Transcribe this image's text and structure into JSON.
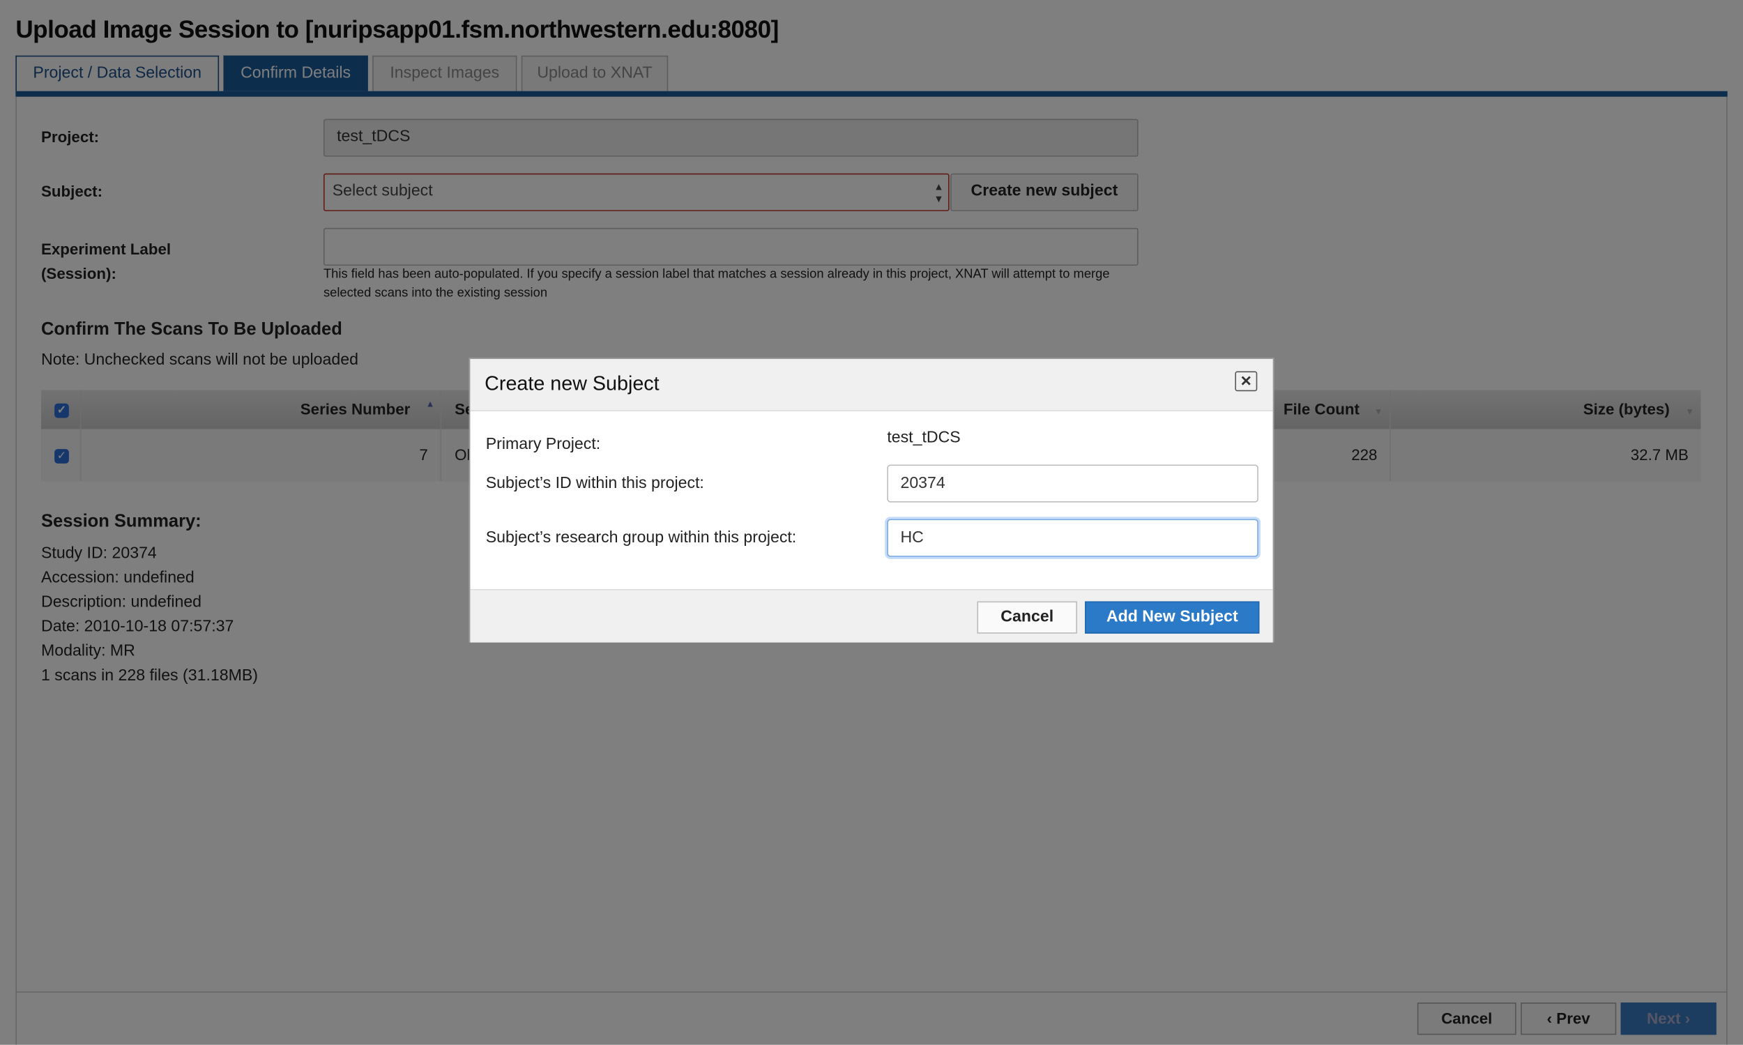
{
  "page": {
    "title": "Upload Image Session to [nuripsapp01.fsm.northwestern.edu:8080]",
    "tabs": [
      {
        "label": "Project / Data Selection",
        "state": "completed"
      },
      {
        "label": "Confirm Details",
        "state": "active"
      },
      {
        "label": "Inspect Images",
        "state": "disabled"
      },
      {
        "label": "Upload to XNAT",
        "state": "disabled"
      }
    ],
    "accent_color": "#1a5a9a"
  },
  "form": {
    "project_label": "Project:",
    "project_value": "test_tDCS",
    "subject_label": "Subject:",
    "subject_select_value": "Select subject",
    "create_subject_button": "Create new subject",
    "experiment_label_line1": "Experiment Label",
    "experiment_label_line2": "(Session):",
    "experiment_value": "",
    "experiment_help_line1": "This field has been auto-populated. If you specify a session label that matches a session already in this project, XNAT will attempt to merge",
    "experiment_help_line2": "selected scans into the existing session"
  },
  "scans": {
    "heading": "Confirm The Scans To Be Uploaded",
    "note": "Note: Unchecked scans will not be uploaded",
    "columns": [
      "Series Number",
      "Se",
      "File Count",
      "Size (bytes)"
    ],
    "select_all_checked": true,
    "rows": [
      {
        "checked": true,
        "series_number": "7",
        "series_partial": "Ol",
        "file_count": "228",
        "size": "32.7 MB"
      }
    ]
  },
  "summary": {
    "heading": "Session Summary:",
    "lines": [
      "Study ID: 20374",
      "Accession: undefined",
      "Description: undefined",
      "Date: 2010-10-18 07:57:37",
      "Modality: MR",
      "1 scans in 228 files (31.18MB)"
    ]
  },
  "footer": {
    "cancel": "Cancel",
    "prev": "Prev",
    "next": "Next"
  },
  "modal": {
    "title": "Create new Subject",
    "close_icon": "close-icon",
    "primary_project_label": "Primary Project:",
    "primary_project_value": "test_tDCS",
    "subject_id_label": "Subject’s ID within this project:",
    "subject_id_value": "20374",
    "group_label": "Subject’s research group within this project:",
    "group_value": "HC",
    "cancel": "Cancel",
    "add": "Add New Subject",
    "add_color": "#2a7ac8"
  }
}
